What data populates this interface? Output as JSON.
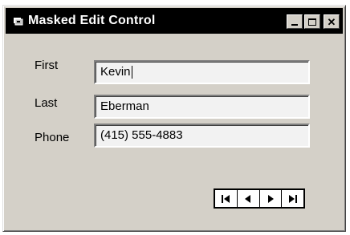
{
  "window": {
    "title": "Masked Edit Control",
    "controls": {
      "minimize_icon": "minimize-icon",
      "maximize_icon": "maximize-icon",
      "close_glyph": "✕"
    }
  },
  "form": {
    "fields": [
      {
        "label": "First",
        "value": "Kevin",
        "focused": true
      },
      {
        "label": "Last",
        "value": "Eberman",
        "focused": false
      },
      {
        "label": "Phone",
        "value": "(415) 555-4883",
        "focused": false
      }
    ]
  },
  "navigator": {
    "buttons": [
      {
        "icon": "first-record-icon"
      },
      {
        "icon": "previous-record-icon"
      },
      {
        "icon": "next-record-icon"
      },
      {
        "icon": "last-record-icon"
      }
    ]
  },
  "colors": {
    "titlebar": "#000000",
    "window_face": "#d4d0c8",
    "field_bg": "#f2f2f2"
  }
}
